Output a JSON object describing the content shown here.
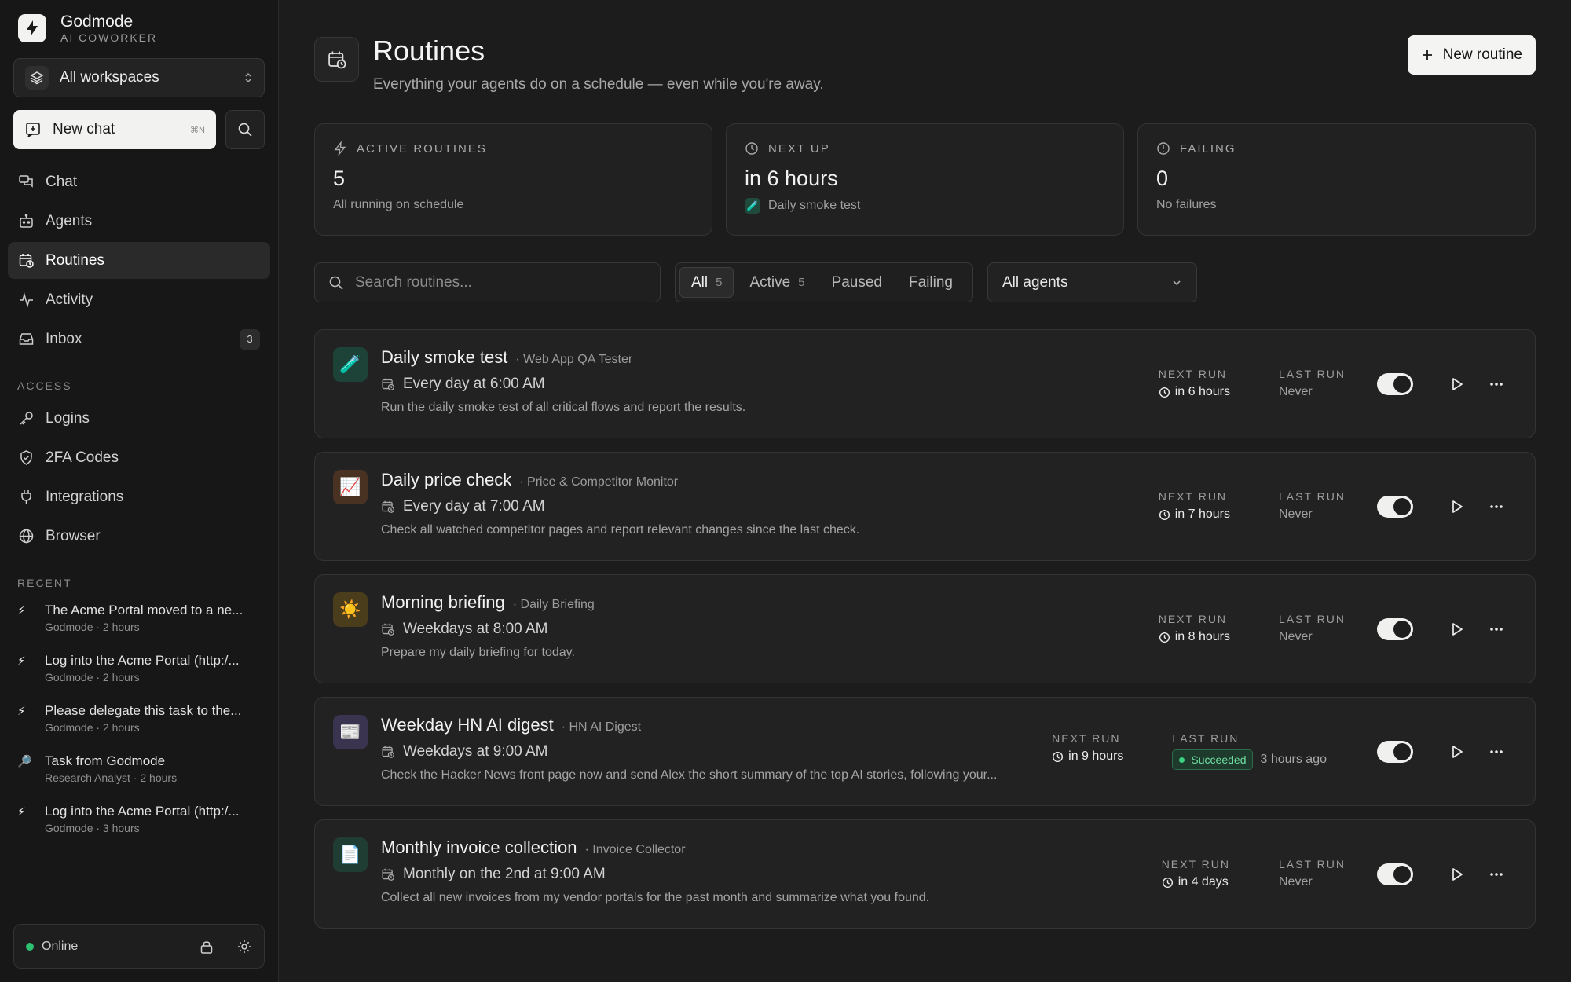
{
  "brand": {
    "name": "Godmode",
    "subtitle": "AI COWORKER"
  },
  "workspace": {
    "label": "All workspaces"
  },
  "new_chat": {
    "label": "New chat",
    "shortcut": "⌘N"
  },
  "nav": [
    {
      "label": "Chat",
      "icon": "chat-icon"
    },
    {
      "label": "Agents",
      "icon": "agents-icon"
    },
    {
      "label": "Routines",
      "icon": "routines-icon",
      "active": true
    },
    {
      "label": "Activity",
      "icon": "activity-icon"
    },
    {
      "label": "Inbox",
      "icon": "inbox-icon",
      "badge": "3"
    }
  ],
  "access": {
    "label": "ACCESS",
    "items": [
      {
        "label": "Logins",
        "icon": "key-icon"
      },
      {
        "label": "2FA Codes",
        "icon": "shield-icon"
      },
      {
        "label": "Integrations",
        "icon": "plug-icon"
      },
      {
        "label": "Browser",
        "icon": "globe-icon"
      }
    ]
  },
  "recent": {
    "label": "RECENT",
    "items": [
      {
        "icon": "⚡",
        "title": "The Acme Portal moved to a ne...",
        "sub": "Godmode · 2 hours"
      },
      {
        "icon": "⚡",
        "title": "Log into the Acme Portal (http:/...",
        "sub": "Godmode · 2 hours"
      },
      {
        "icon": "⚡",
        "title": "Please delegate this task to the...",
        "sub": "Godmode · 2 hours"
      },
      {
        "icon": "🔎",
        "title": "Task from Godmode",
        "sub": "Research Analyst · 2 hours"
      },
      {
        "icon": "⚡",
        "title": "Log into the Acme Portal (http:/...",
        "sub": "Godmode · 3 hours"
      }
    ]
  },
  "status": {
    "label": "Online",
    "color": "#2fbf71"
  },
  "header": {
    "title": "Routines",
    "subtitle": "Everything your agents do on a schedule — even while you're away.",
    "new_button": "New routine"
  },
  "stats": [
    {
      "label": "ACTIVE ROUTINES",
      "icon": "bolt-icon",
      "value": "5",
      "sub": "All running on schedule"
    },
    {
      "label": "NEXT UP",
      "icon": "clock-icon",
      "value": "in 6 hours",
      "sub": "Daily smoke test",
      "sub_emoji": "🧪"
    },
    {
      "label": "FAILING",
      "icon": "alert-icon",
      "value": "0",
      "sub": "No failures"
    }
  ],
  "search": {
    "placeholder": "Search routines..."
  },
  "segments": [
    {
      "label": "All",
      "count": "5",
      "active": true
    },
    {
      "label": "Active",
      "count": "5"
    },
    {
      "label": "Paused",
      "count": ""
    },
    {
      "label": "Failing",
      "count": ""
    }
  ],
  "agent_filter": {
    "label": "All agents"
  },
  "run_labels": {
    "next": "NEXT RUN",
    "last": "LAST RUN"
  },
  "routines": [
    {
      "emoji": "🧪",
      "emoji_bg": "#1d4237",
      "title": "Daily smoke test",
      "agent": "· Web App QA Tester",
      "schedule": "Every day at 6:00 AM",
      "desc": "Run the daily smoke test of all critical flows and report the results.",
      "next": "in 6 hours",
      "last": "Never",
      "enabled": true
    },
    {
      "emoji": "📈",
      "emoji_bg": "#4a3222",
      "title": "Daily price check",
      "agent": "· Price & Competitor Monitor",
      "schedule": "Every day at 7:00 AM",
      "desc": "Check all watched competitor pages and report relevant changes since the last check.",
      "next": "in 7 hours",
      "last": "Never",
      "enabled": true
    },
    {
      "emoji": "☀️",
      "emoji_bg": "#4a3d1c",
      "title": "Morning briefing",
      "agent": "· Daily Briefing",
      "schedule": "Weekdays at 8:00 AM",
      "desc": "Prepare my daily briefing for today.",
      "next": "in 8 hours",
      "last": "Never",
      "enabled": true
    },
    {
      "emoji": "📰",
      "emoji_bg": "#3a3450",
      "title": "Weekday HN AI digest",
      "agent": "· HN AI Digest",
      "schedule": "Weekdays at 9:00 AM",
      "desc": "Check the Hacker News front page now and send Alex the short summary of the top AI stories, following your...",
      "next": "in 9 hours",
      "last": "Succeeded",
      "last_ago": "3 hours ago",
      "enabled": true
    },
    {
      "emoji": "📄",
      "emoji_bg": "#1f3d33",
      "title": "Monthly invoice collection",
      "agent": "· Invoice Collector",
      "schedule": "Monthly on the 2nd at 9:00 AM",
      "desc": "Collect all new invoices from my vendor portals for the past month and summarize what you found.",
      "next": "in 4 days",
      "last": "Never",
      "enabled": true
    }
  ]
}
